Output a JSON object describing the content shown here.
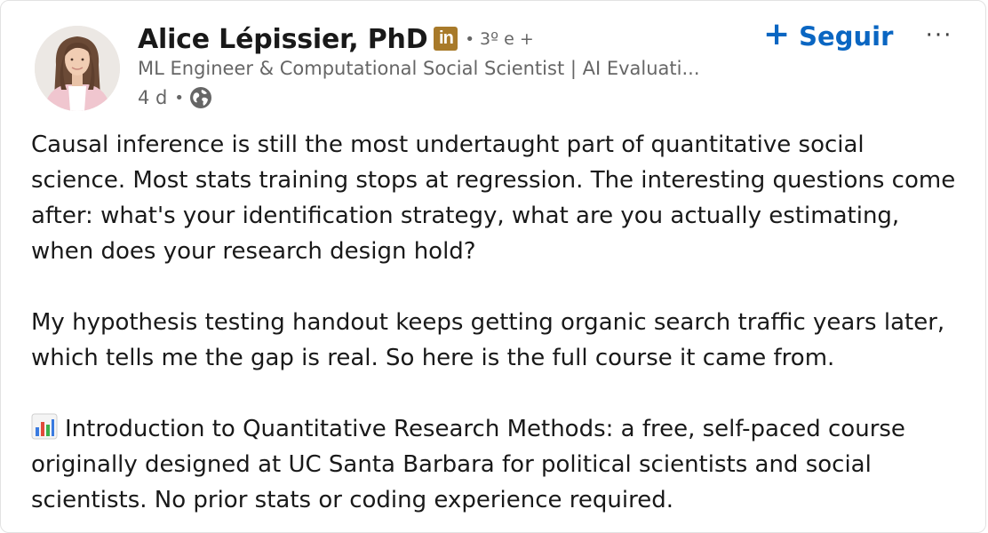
{
  "author": {
    "name": "Alice Lépissier, PhD",
    "linkedin_badge": "in",
    "degree": "3º e +",
    "headline": "ML Engineer & Computational Social Scientist | AI Evaluati...",
    "time_ago": "4 d",
    "visibility_icon": "globe-icon"
  },
  "actions": {
    "follow_plus": "+",
    "follow_label": "Seguir",
    "more_label": "···"
  },
  "post": {
    "paragraph1_lines": [
      "Causal inference is still the most undertaught part of quantitative social",
      "science. Most stats training stops at regression. The interesting questions come",
      "after: what's your identification strategy, what are you actually estimating,",
      "when does your research design hold?"
    ],
    "paragraph2_lines": [
      "My hypothesis testing handout keeps getting organic search traffic years later,",
      "which tells me the gap is real. So here is the full course it came from."
    ],
    "paragraph3_icon": "bar-chart-emoji-icon",
    "paragraph3_lines": [
      "Introduction to Quantitative Research Methods: a free, self-paced course",
      "originally designed at UC Santa Barbara for political scientists and social",
      "scientists. No prior stats or coding experience required."
    ]
  },
  "colors": {
    "accent_blue": "#0a66c2",
    "secondary_text": "#666666",
    "badge_gold": "#a87a2a"
  }
}
